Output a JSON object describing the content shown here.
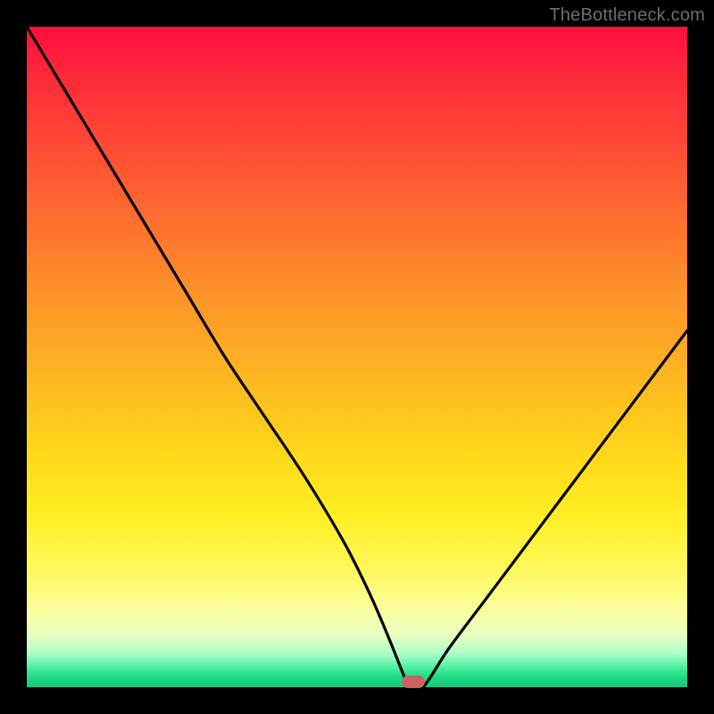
{
  "watermark": "TheBottleneck.com",
  "colors": {
    "frame": "#000000",
    "curve": "#000000",
    "marker": "#c96260"
  },
  "chart_data": {
    "type": "line",
    "title": "",
    "xlabel": "",
    "ylabel": "",
    "xlim": [
      0,
      100
    ],
    "ylim": [
      0,
      100
    ],
    "grid": false,
    "legend": false,
    "series": [
      {
        "name": "bottleneck-curve",
        "x": [
          0,
          6,
          12,
          18,
          24,
          30,
          36,
          42,
          48,
          52,
          55,
          57,
          58,
          60,
          64,
          70,
          76,
          82,
          88,
          94,
          100
        ],
        "y": [
          100,
          90,
          80,
          70,
          60,
          50,
          41,
          32,
          22,
          14,
          7,
          2,
          0,
          0,
          6,
          14,
          22,
          30,
          38,
          46,
          54
        ]
      }
    ],
    "marker": {
      "x": 58.5,
      "y": 0.8
    },
    "background_gradient": {
      "direction": "top-to-bottom",
      "stops": [
        {
          "pos": 0.0,
          "color": "#ff0d3e"
        },
        {
          "pos": 0.5,
          "color": "#ffb020"
        },
        {
          "pos": 0.85,
          "color": "#fff85a"
        },
        {
          "pos": 1.0,
          "color": "#14c978"
        }
      ]
    }
  }
}
